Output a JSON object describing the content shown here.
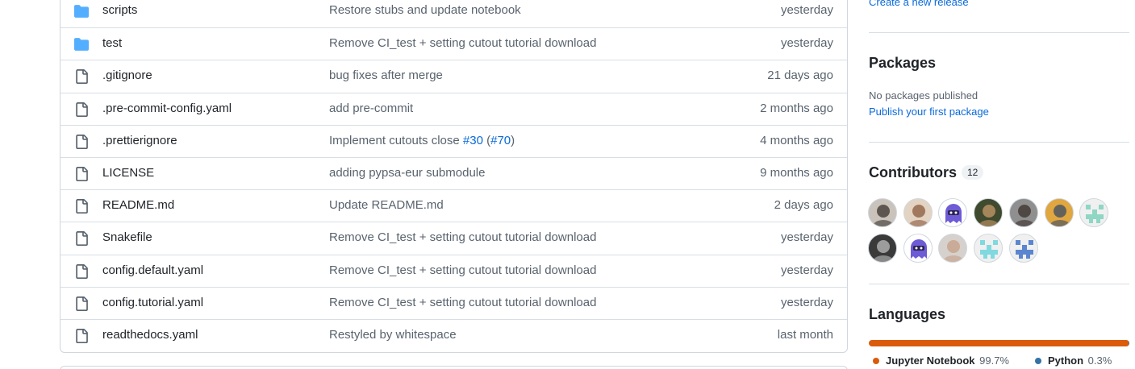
{
  "files": [
    {
      "type": "folder",
      "icon": "folder-icon",
      "name": "scripts",
      "message": "Restore stubs and update notebook",
      "time": "yesterday"
    },
    {
      "type": "folder",
      "icon": "folder-icon",
      "name": "test",
      "message": "Remove CI_test + setting cutout tutorial download",
      "time": "yesterday"
    },
    {
      "type": "file",
      "icon": "file-icon",
      "name": ".gitignore",
      "message": "bug fixes after merge",
      "time": "21 days ago"
    },
    {
      "type": "file",
      "icon": "file-icon",
      "name": ".pre-commit-config.yaml",
      "message": "add pre-commit",
      "time": "2 months ago"
    },
    {
      "type": "file",
      "icon": "file-icon",
      "name": ".prettierignore",
      "message": "Implement cutouts close ",
      "message_link1": "#30",
      "message_mid": " (",
      "message_link2": "#70",
      "message_end": ")",
      "time": "4 months ago"
    },
    {
      "type": "file",
      "icon": "file-icon",
      "name": "LICENSE",
      "message": "adding pypsa-eur submodule",
      "time": "9 months ago"
    },
    {
      "type": "file",
      "icon": "file-icon",
      "name": "README.md",
      "message": "Update README.md",
      "time": "2 days ago"
    },
    {
      "type": "file",
      "icon": "file-icon",
      "name": "Snakefile",
      "message": "Remove CI_test + setting cutout tutorial download",
      "time": "yesterday"
    },
    {
      "type": "file",
      "icon": "file-icon",
      "name": "config.default.yaml",
      "message": "Remove CI_test + setting cutout tutorial download",
      "time": "yesterday"
    },
    {
      "type": "file",
      "icon": "file-icon",
      "name": "config.tutorial.yaml",
      "message": "Remove CI_test + setting cutout tutorial download",
      "time": "yesterday"
    },
    {
      "type": "file",
      "icon": "file-icon",
      "name": "readthedocs.yaml",
      "message": "Restyled by whitespace",
      "time": "last month"
    }
  ],
  "sidebar": {
    "release_link": "Create a new release",
    "packages": {
      "title": "Packages",
      "none_text": "No packages published",
      "publish_link": "Publish your first package"
    },
    "contributors": {
      "title": "Contributors",
      "count": "12",
      "avatars": [
        {
          "kind": "photo",
          "bg": "#c9c3bb",
          "fg": "#3a322d"
        },
        {
          "kind": "photo",
          "bg": "#e3d3c2",
          "fg": "#8a5a3c"
        },
        {
          "kind": "octo",
          "bg": "#ffffff",
          "fg": "#6e5bd6"
        },
        {
          "kind": "photo",
          "bg": "#3f4a2e",
          "fg": "#c89a6a"
        },
        {
          "kind": "photo",
          "bg": "#8f8f8f",
          "fg": "#3a2f2a"
        },
        {
          "kind": "photo",
          "bg": "#e0a640",
          "fg": "#3a4a66"
        },
        {
          "kind": "identicon",
          "bg": "#f0f0f0",
          "fg": "#8fd6c5"
        },
        {
          "kind": "photo",
          "bg": "#3a3a3a",
          "fg": "#bdbdbd"
        },
        {
          "kind": "octo",
          "bg": "#ffffff",
          "fg": "#6e5bd6"
        },
        {
          "kind": "photo",
          "bg": "#d6d1cc",
          "fg": "#c49d86"
        },
        {
          "kind": "identicon",
          "bg": "#f0f0f0",
          "fg": "#7fd9df"
        },
        {
          "kind": "identicon",
          "bg": "#f0f0f0",
          "fg": "#5b86cf"
        }
      ]
    },
    "languages": {
      "title": "Languages",
      "items": [
        {
          "name": "Jupyter Notebook",
          "percent": "99.7%",
          "value": 99.7,
          "color": "#da5b0b"
        },
        {
          "name": "Python",
          "percent": "0.3%",
          "value": 0.3,
          "color": "#3572a5"
        }
      ]
    }
  }
}
